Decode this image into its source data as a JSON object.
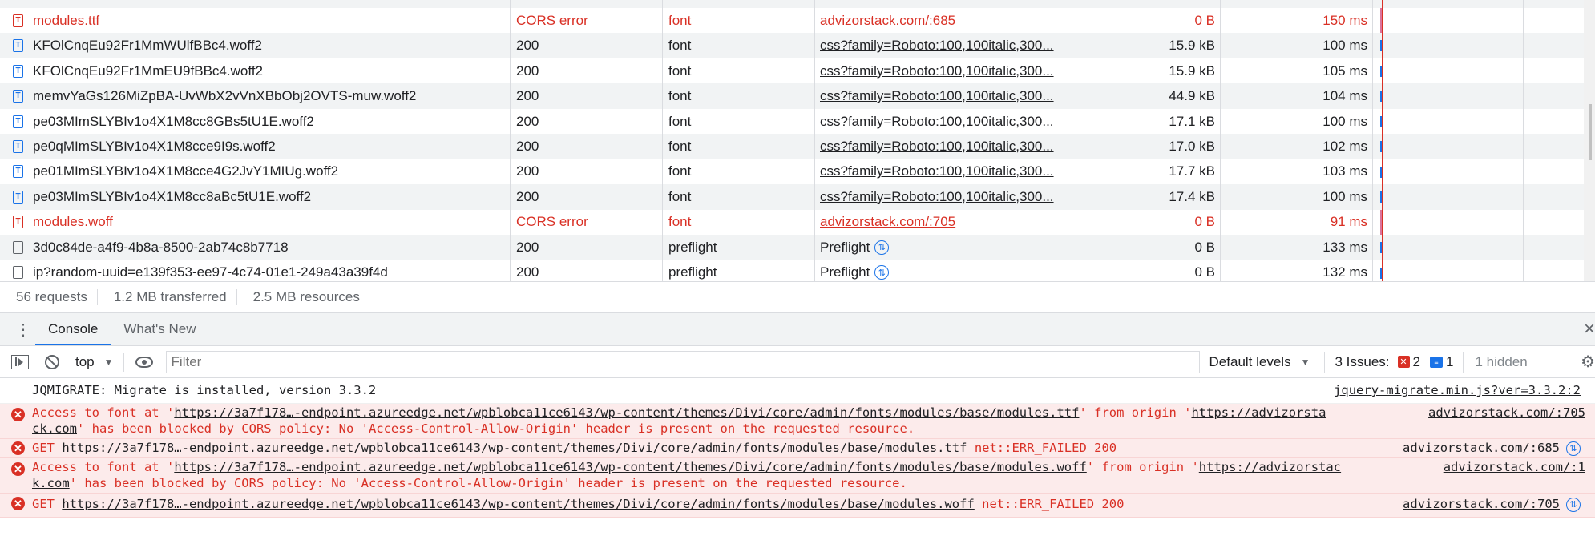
{
  "network": {
    "rows": [
      {
        "name": "modules.ttf",
        "status": "CORS error",
        "type": "font",
        "initiator": "advizorstack.com/:685",
        "size": "0 B",
        "time": "150 ms",
        "error": true,
        "icon": "font-file-icon"
      },
      {
        "name": "KFOlCnqEu92Fr1MmWUlfBBc4.woff2",
        "status": "200",
        "type": "font",
        "initiator": "css?family=Roboto:100,100italic,300...",
        "size": "15.9 kB",
        "time": "100 ms",
        "error": false,
        "icon": "font-file-icon"
      },
      {
        "name": "KFOlCnqEu92Fr1MmEU9fBBc4.woff2",
        "status": "200",
        "type": "font",
        "initiator": "css?family=Roboto:100,100italic,300...",
        "size": "15.9 kB",
        "time": "105 ms",
        "error": false,
        "icon": "font-file-icon"
      },
      {
        "name": "memvYaGs126MiZpBA-UvWbX2vVnXBbObj2OVTS-muw.woff2",
        "status": "200",
        "type": "font",
        "initiator": "css?family=Roboto:100,100italic,300...",
        "size": "44.9 kB",
        "time": "104 ms",
        "error": false,
        "icon": "font-file-icon"
      },
      {
        "name": "pe03MImSLYBIv1o4X1M8cc8GBs5tU1E.woff2",
        "status": "200",
        "type": "font",
        "initiator": "css?family=Roboto:100,100italic,300...",
        "size": "17.1 kB",
        "time": "100 ms",
        "error": false,
        "icon": "font-file-icon"
      },
      {
        "name": "pe0qMImSLYBIv1o4X1M8cce9I9s.woff2",
        "status": "200",
        "type": "font",
        "initiator": "css?family=Roboto:100,100italic,300...",
        "size": "17.0 kB",
        "time": "102 ms",
        "error": false,
        "icon": "font-file-icon"
      },
      {
        "name": "pe01MImSLYBIv1o4X1M8cce4G2JvY1MIUg.woff2",
        "status": "200",
        "type": "font",
        "initiator": "css?family=Roboto:100,100italic,300...",
        "size": "17.7 kB",
        "time": "103 ms",
        "error": false,
        "icon": "font-file-icon"
      },
      {
        "name": "pe03MImSLYBIv1o4X1M8cc8aBc5tU1E.woff2",
        "status": "200",
        "type": "font",
        "initiator": "css?family=Roboto:100,100italic,300...",
        "size": "17.4 kB",
        "time": "100 ms",
        "error": false,
        "icon": "font-file-icon"
      },
      {
        "name": "modules.woff",
        "status": "CORS error",
        "type": "font",
        "initiator": "advizorstack.com/:705",
        "size": "0 B",
        "time": "91 ms",
        "error": true,
        "icon": "font-file-icon"
      },
      {
        "name": "3d0c84de-a4f9-4b8a-8500-2ab74c8b7718",
        "status": "200",
        "type": "preflight",
        "initiator": "Preflight",
        "size": "0 B",
        "time": "133 ms",
        "error": false,
        "icon": "generic-file-icon",
        "preflight": true
      },
      {
        "name": "ip?random-uuid=e139f353-ee97-4c74-01e1-249a43a39f4d",
        "status": "200",
        "type": "preflight",
        "initiator": "Preflight",
        "size": "0 B",
        "time": "132 ms",
        "error": false,
        "icon": "generic-file-icon",
        "preflight": true
      }
    ]
  },
  "status_bar": {
    "requests": "56 requests",
    "transferred": "1.2 MB transferred",
    "resources": "2.5 MB resources"
  },
  "drawer": {
    "tabs": [
      "Console",
      "What's New"
    ],
    "close": "×"
  },
  "toolbar": {
    "context": "top",
    "filter_placeholder": "Filter",
    "levels": "Default levels",
    "issues_label": "3 Issues:",
    "issues_errors": "2",
    "issues_info": "1",
    "hidden": "1 hidden"
  },
  "console": {
    "info": {
      "text": "JQMIGRATE: Migrate is installed, version 3.3.2",
      "src": "jquery-migrate.min.js?ver=3.3.2:2"
    },
    "cors1": {
      "pre": "Access to font at '",
      "url": "https://3a7f178…-endpoint.azureedge.net/wpblobca11ce6143/wp-content/themes/Divi/core/admin/fonts/modules/base/modules.ttf",
      "mid": "' from origin '",
      "origin_a": "https://advizorsta",
      "origin_b": "ck.com",
      "line2": "' has been blocked by CORS policy: No 'Access-Control-Allow-Origin' header is present on the requested resource.",
      "src": "advizorstack.com/:705"
    },
    "get1": {
      "pre": "GET ",
      "url": "https://3a7f178…-endpoint.azureedge.net/wpblobca11ce6143/wp-content/themes/Divi/core/admin/fonts/modules/base/modules.ttf",
      "post": " net::ERR_FAILED 200",
      "src": "advizorstack.com/:685"
    },
    "cors2": {
      "pre": "Access to font at '",
      "url": "https://3a7f178…-endpoint.azureedge.net/wpblobca11ce6143/wp-content/themes/Divi/core/admin/fonts/modules/base/modules.woff",
      "mid": "' from origin '",
      "origin_a": "https://advizorstac",
      "origin_b": "k.com",
      "line2": "' has been blocked by CORS policy: No 'Access-Control-Allow-Origin' header is present on the requested resource.",
      "src": "advizorstack.com/:1"
    },
    "get2": {
      "pre": "GET ",
      "url": "https://3a7f178…-endpoint.azureedge.net/wpblobca11ce6143/wp-content/themes/Divi/core/admin/fonts/modules/base/modules.woff",
      "post": " net::ERR_FAILED 200",
      "src": "advizorstack.com/:705"
    }
  },
  "colors": {
    "error": "#d93025",
    "accent": "#1a73e8"
  }
}
